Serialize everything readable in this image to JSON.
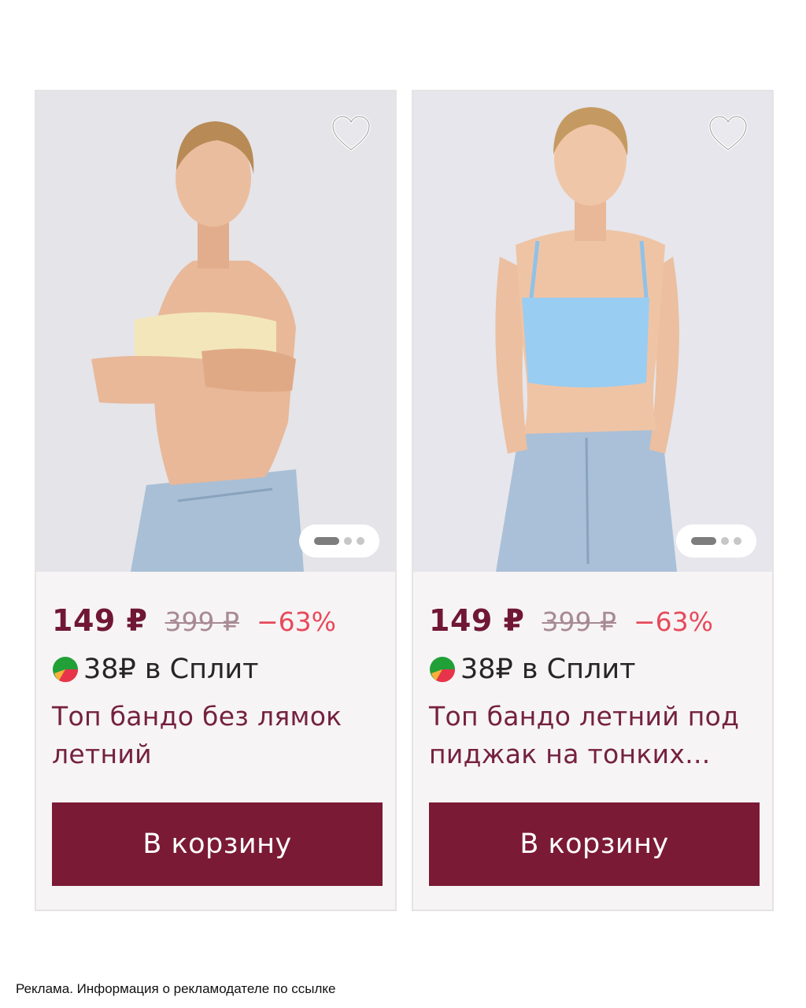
{
  "products": [
    {
      "price": "149 ₽",
      "old_price": "399 ₽",
      "discount": "−63%",
      "split": "38₽ в Сплит",
      "title": "Топ бандо без лямок летний",
      "cart_label": "В корзину",
      "top_color": "#f3e6bb",
      "carousel_index": 1,
      "carousel_total": 3
    },
    {
      "price": "149 ₽",
      "old_price": "399 ₽",
      "discount": "−63%",
      "split": "38₽ в Сплит",
      "title": "Топ бандо летний под пиджак на тонких...",
      "cart_label": "В корзину",
      "top_color": "#99cdf2",
      "carousel_index": 1,
      "carousel_total": 3
    }
  ],
  "ad_note": "Реклама. Информация о рекламодателе по ссылке",
  "colors": {
    "brand": "#7b1a35",
    "price": "#701735",
    "discount": "#e64a5b",
    "old_price": "#a78a95"
  },
  "icons": {
    "favorite": "heart-outline-icon",
    "split": "split-logo-icon"
  }
}
